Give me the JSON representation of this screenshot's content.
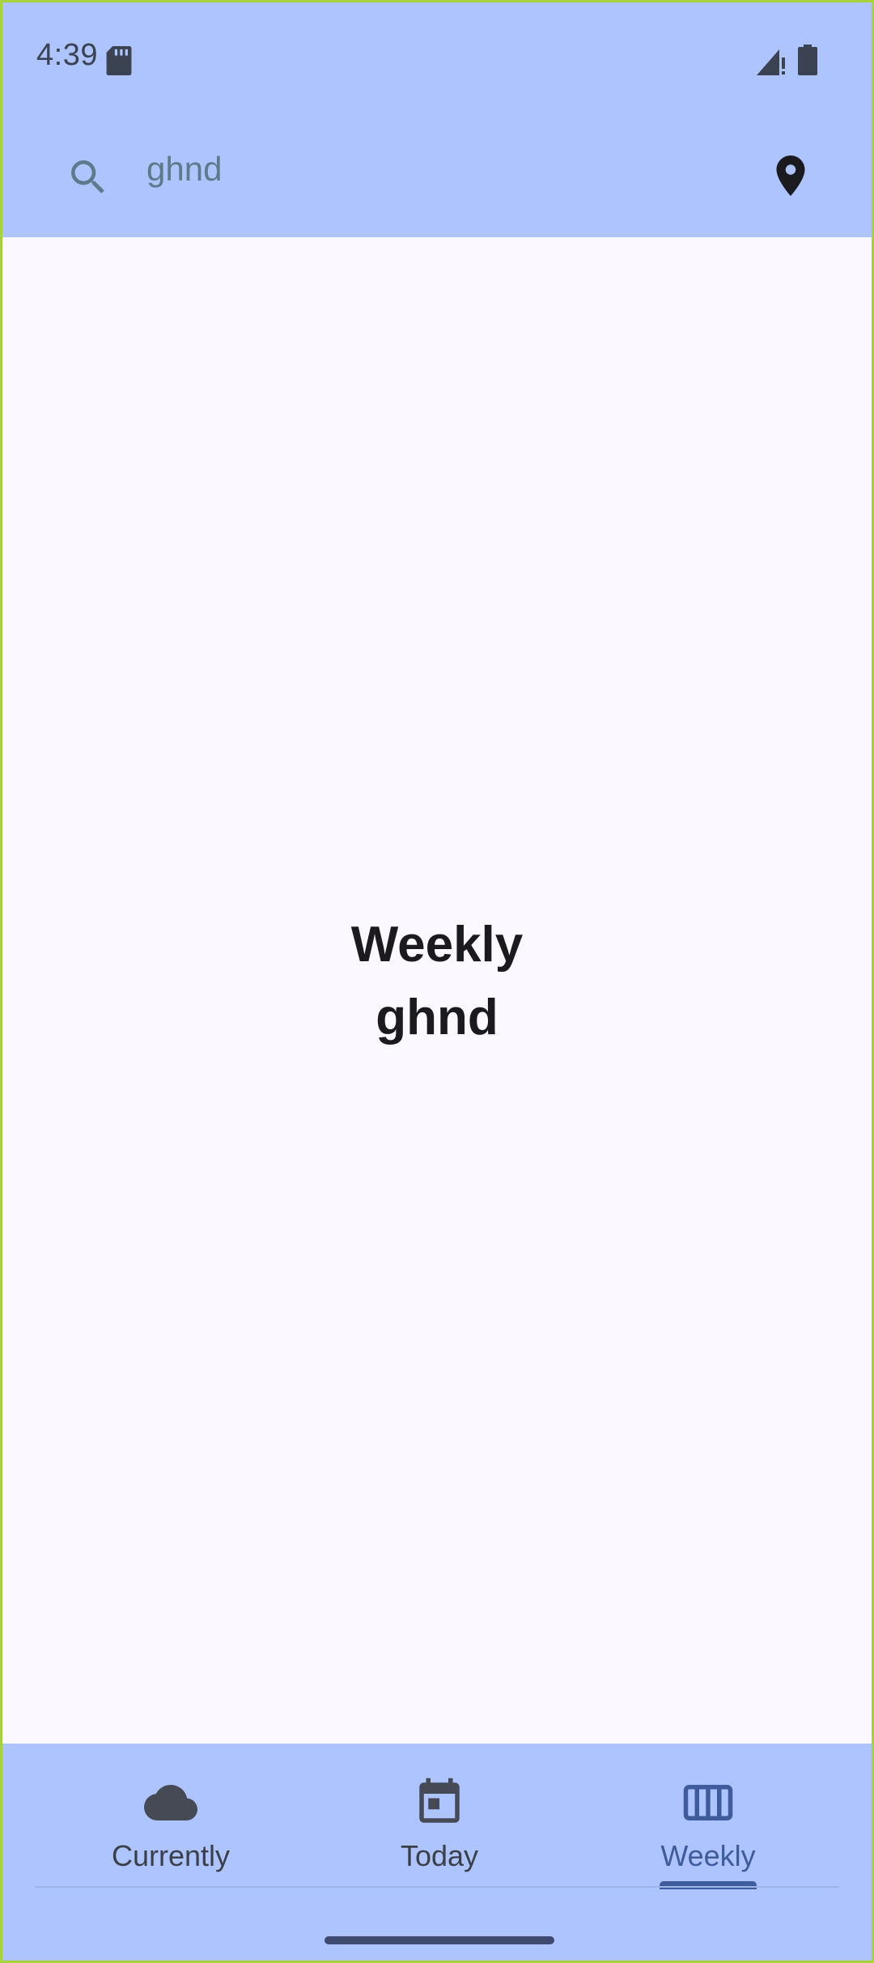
{
  "status_bar": {
    "time": "4:39",
    "icons": [
      "sd-card-icon",
      "signal-icon",
      "battery-icon"
    ]
  },
  "search": {
    "value": "ghnd",
    "icon": "search-icon",
    "location_icon": "location-pin-icon"
  },
  "main": {
    "title": "Weekly",
    "subtitle": "ghnd"
  },
  "bottom_nav": {
    "items": [
      {
        "label": "Currently",
        "icon": "cloud-icon",
        "active": false
      },
      {
        "label": "Today",
        "icon": "calendar-icon",
        "active": false
      },
      {
        "label": "Weekly",
        "icon": "view-week-icon",
        "active": true
      }
    ]
  },
  "colors": {
    "bar_background": "#aec4ff",
    "content_background": "#fbf8ff",
    "accent": "#3e5c9b",
    "text_dark": "#1b1b1f"
  }
}
